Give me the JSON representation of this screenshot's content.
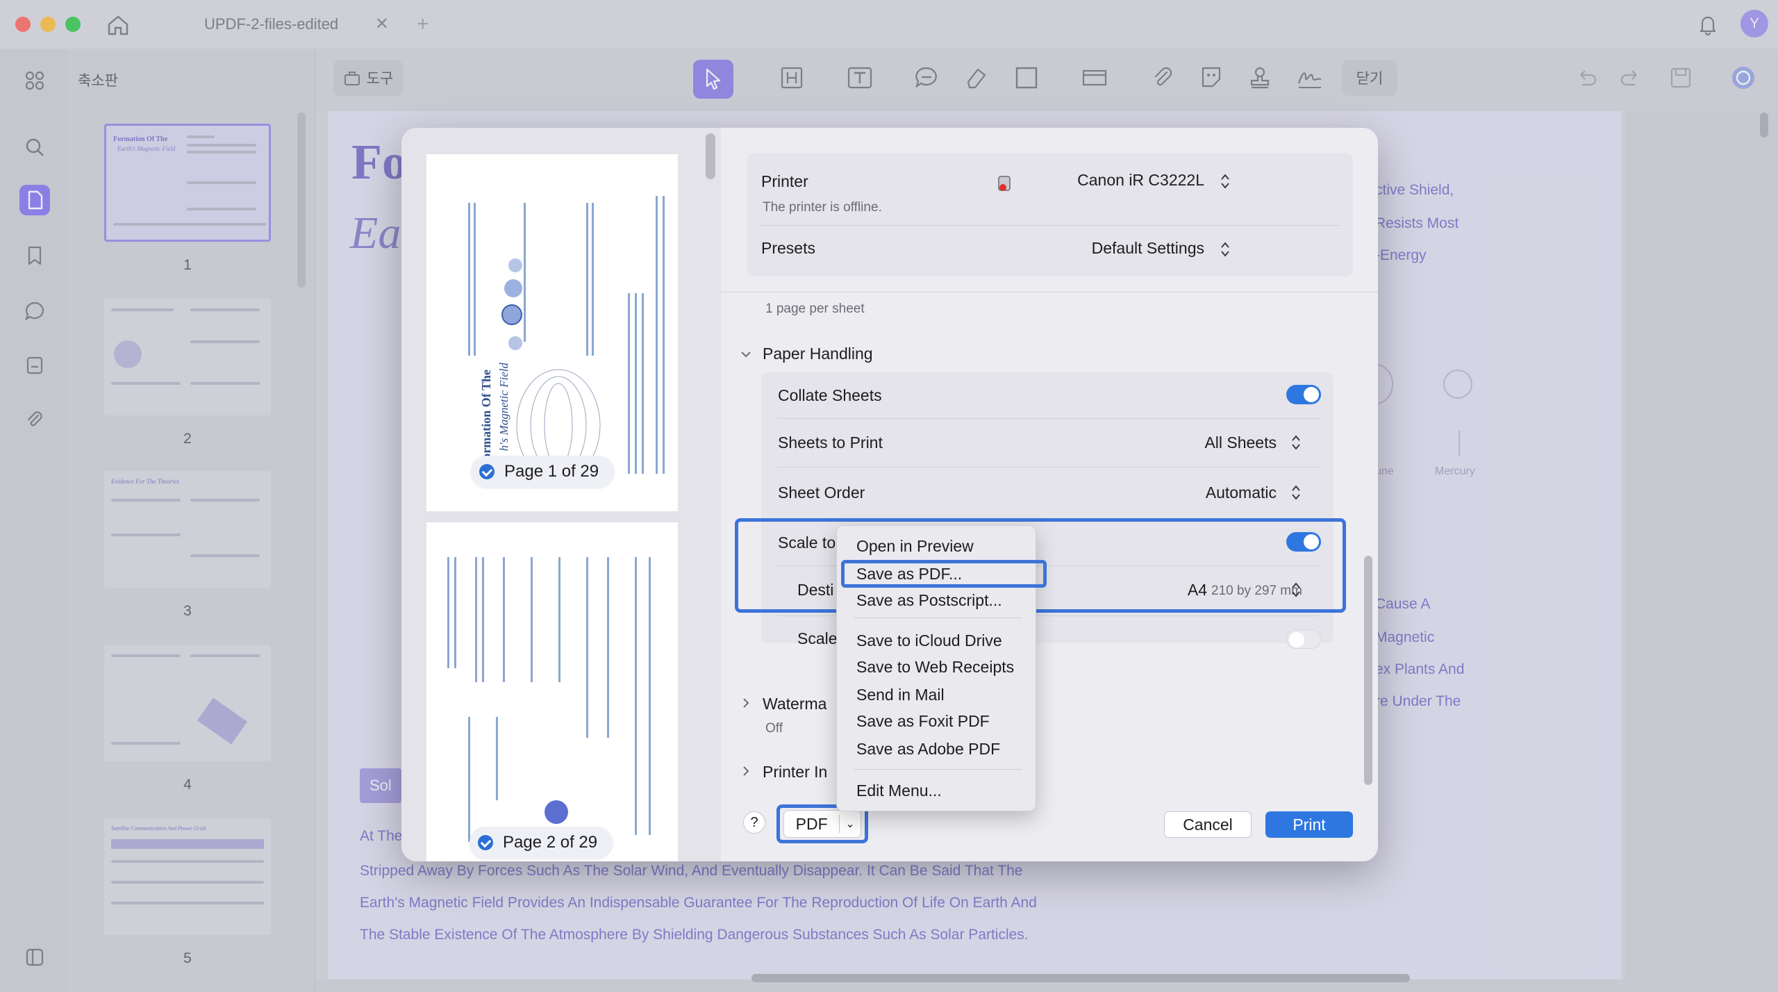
{
  "window": {
    "tab_title": "UPDF-2-files-edited",
    "tab_close": "✕",
    "tab_add": "+",
    "avatar_letter": "Y"
  },
  "sidebar": {
    "title": "축소판",
    "thumbnails": [
      {
        "num": "1",
        "heading": "Formation Of The",
        "subheading": "Earth's Magnetic Field"
      },
      {
        "num": "2"
      },
      {
        "num": "3",
        "heading": "Evidence For The Theories"
      },
      {
        "num": "4"
      },
      {
        "num": "5",
        "heading": "Satellite Communication And Power Grids"
      }
    ]
  },
  "toolbar": {
    "tools_label": "도구",
    "close_label": "닫기"
  },
  "document": {
    "title_line1": "Fo",
    "title_line2": "Ea",
    "right_lines_top": [
      "ctive Shield,",
      "Resists Most",
      "-Energy"
    ],
    "right_lines_mid": [
      "Cause A",
      "Magnetic",
      "ex Plants And",
      "re Under The"
    ],
    "planet_labels": [
      "une",
      "Mercury"
    ],
    "sol_button": "Sol",
    "para_start": "At The",
    "paragraph": [
      "Stripped Away By Forces Such As The Solar Wind, And Eventually Disappear. It Can Be Said That The",
      "Earth's Magnetic Field Provides An Indispensable Guarantee For The Reproduction Of Life On Earth And",
      "The Stable Existence Of The Atmosphere By Shielding Dangerous Substances Such As Solar Particles."
    ]
  },
  "print_dialog": {
    "preview": {
      "page1_badge": "Page 1 of 29",
      "page2_badge": "Page 2 of 29",
      "page1_title": "Formation Of The",
      "page1_subtitle": "h's Magnetic Field"
    },
    "printer_label": "Printer",
    "printer_value": "Canon iR C3222L",
    "printer_status": "The printer is offline.",
    "presets_label": "Presets",
    "presets_value": "Default Settings",
    "layout_sub": "1 page per sheet",
    "paper_handling": {
      "title": "Paper Handling",
      "collate_label": "Collate Sheets",
      "collate_on": true,
      "sheets_label": "Sheets to Print",
      "sheets_value": "All Sheets",
      "order_label": "Sheet Order",
      "order_value": "Automatic"
    },
    "scale_section": {
      "scale_to_label": "Scale to",
      "dest_label": "Desti",
      "dest_value": "A4",
      "dest_dims": "210 by 297 mm",
      "scale_label": "Scale"
    },
    "watermark": {
      "title": "Waterma",
      "value": "Off"
    },
    "printer_info": {
      "title": "Printer In"
    },
    "help": "?",
    "pdf_label": "PDF",
    "pdf_caret": "⌄",
    "cancel": "Cancel",
    "print": "Print"
  },
  "pdf_menu": {
    "items_group1": [
      "Open in Preview",
      "Save as PDF...",
      "Save as Postscript..."
    ],
    "items_group2": [
      "Save to iCloud Drive",
      "Save to Web Receipts",
      "Send in Mail",
      "Save as Foxit PDF",
      "Save as Adobe PDF"
    ],
    "items_group3": [
      "Edit Menu..."
    ],
    "highlighted": "Save as PDF..."
  },
  "colors": {
    "accent": "#2f77e0",
    "highlight_outline": "#3c74d8",
    "app_accent": "#7d6ef0"
  }
}
